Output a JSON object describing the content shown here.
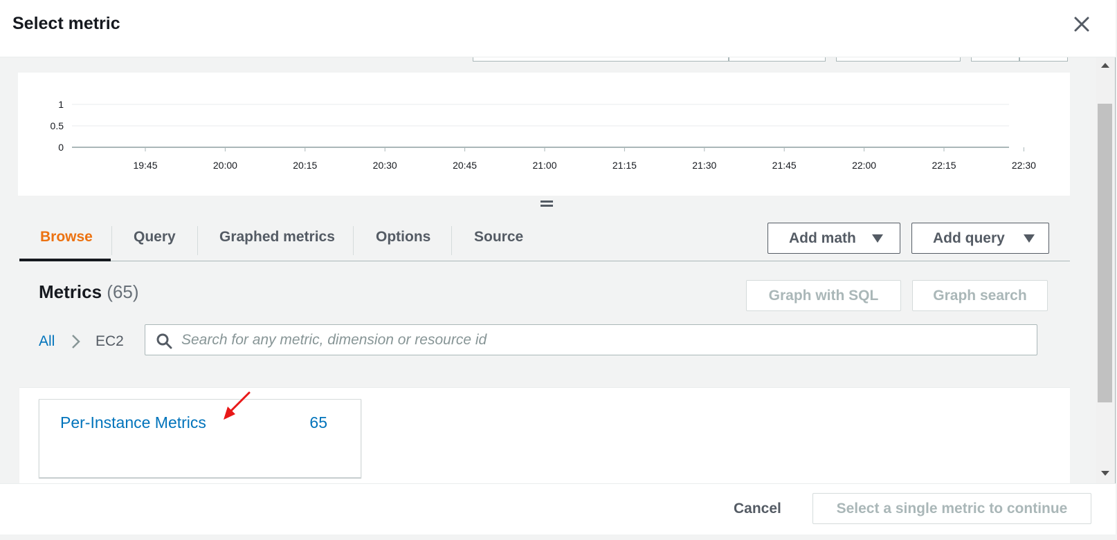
{
  "modal": {
    "title": "Select metric",
    "close_icon": "close-icon"
  },
  "chart_data": {
    "type": "line",
    "x": [
      "19:45",
      "20:00",
      "20:15",
      "20:30",
      "20:45",
      "21:00",
      "21:15",
      "21:30",
      "21:45",
      "22:00",
      "22:15",
      "22:30"
    ],
    "series": [],
    "y_ticks": [
      "1",
      "0.5",
      "0"
    ],
    "ylim": [
      0,
      1
    ],
    "grid": true
  },
  "tabs": [
    {
      "label": "Browse",
      "active": true
    },
    {
      "label": "Query",
      "active": false
    },
    {
      "label": "Graphed metrics",
      "active": false
    },
    {
      "label": "Options",
      "active": false
    },
    {
      "label": "Source",
      "active": false
    }
  ],
  "actions": {
    "add_math": "Add math",
    "add_query": "Add query"
  },
  "metrics": {
    "heading": "Metrics",
    "count": "(65)",
    "graph_with_sql": "Graph with SQL",
    "graph_search": "Graph search",
    "breadcrumb": {
      "all": "All",
      "current": "EC2"
    },
    "search_placeholder": "Search for any metric, dimension or resource id",
    "namespaces": [
      {
        "label": "Per-Instance Metrics",
        "count": "65"
      }
    ]
  },
  "footer": {
    "cancel": "Cancel",
    "continue": "Select a single metric to continue"
  },
  "colors": {
    "accent_orange": "#ec7211",
    "link_blue": "#0073bb",
    "annotation_red": "#e81818"
  }
}
